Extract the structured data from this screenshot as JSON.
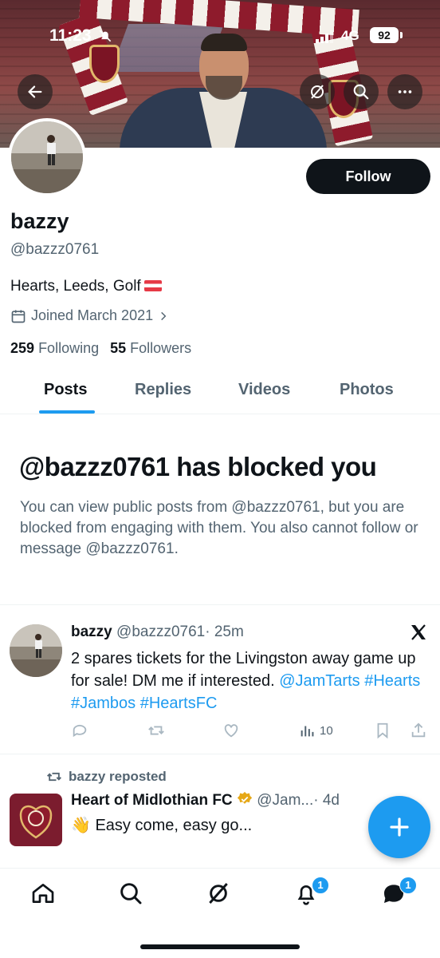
{
  "status_bar": {
    "time": "11:23",
    "network": "4G",
    "battery": "92"
  },
  "profile": {
    "name": "bazzy",
    "handle": "@bazzz0761",
    "bio": "Hearts, Leeds, Golf",
    "joined": "Joined March 2021",
    "following_count": "259",
    "following_label": "Following",
    "followers_count": "55",
    "followers_label": "Followers",
    "follow_label": "Follow"
  },
  "tabs": [
    {
      "label": "Posts",
      "active": true
    },
    {
      "label": "Replies",
      "active": false
    },
    {
      "label": "Videos",
      "active": false
    },
    {
      "label": "Photos",
      "active": false
    }
  ],
  "blocked": {
    "title": "@bazzz0761 has blocked you",
    "message": "You can view public posts from @bazzz0761, but you are blocked from engaging with them. You also cannot follow or message @bazzz0761."
  },
  "post": {
    "author": "bazzy",
    "handle": "@bazzz0761",
    "time": "· 25m",
    "text": "2 spares tickets for the Livingston away game up for sale! DM me if interested.",
    "mention": "@JamTarts",
    "hashtags": "#Hearts #Jambos #HeartsFC",
    "views": "10"
  },
  "repost": {
    "reposted_by": "bazzy reposted",
    "author": "Heart of Midlothian FC",
    "handle": "@Jam...",
    "time": "· 4d",
    "text": "Easy come, easy go...",
    "emoji": "👋"
  },
  "nav": {
    "notifications_badge": "1",
    "messages_badge": "1"
  },
  "colors": {
    "accent": "#1d9bf0",
    "text": "#0f1419",
    "muted": "#536471"
  }
}
